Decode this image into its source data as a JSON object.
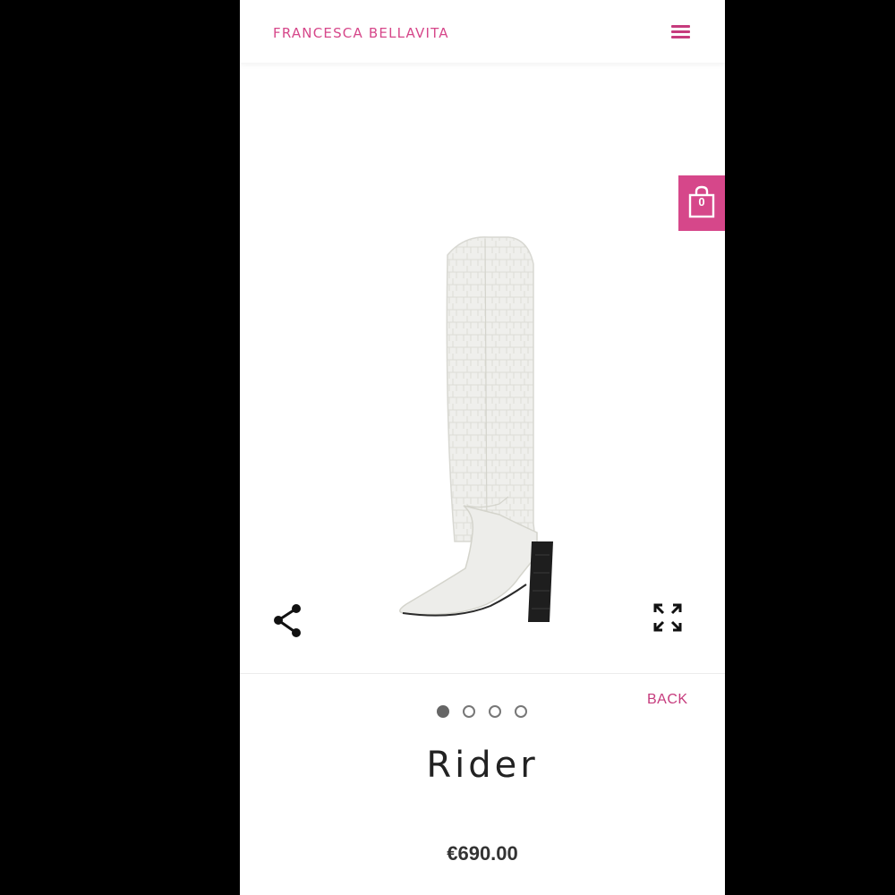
{
  "header": {
    "brand": "FRANCESCA BELLAVITA",
    "menu_icon": "hamburger-menu-icon"
  },
  "cart": {
    "count": "0",
    "icon": "shopping-bag-icon"
  },
  "product": {
    "name": "Rider",
    "price": "€690.00",
    "image": "white croc-embossed knee-high boot with black block heel"
  },
  "gallery": {
    "share_icon": "share-icon",
    "expand_icon": "fullscreen-expand-icon",
    "slides": 4,
    "active_slide": 1
  },
  "nav": {
    "back_label": "BACK"
  },
  "colors": {
    "brand_pink": "#d6478a",
    "background": "#ffffff"
  }
}
